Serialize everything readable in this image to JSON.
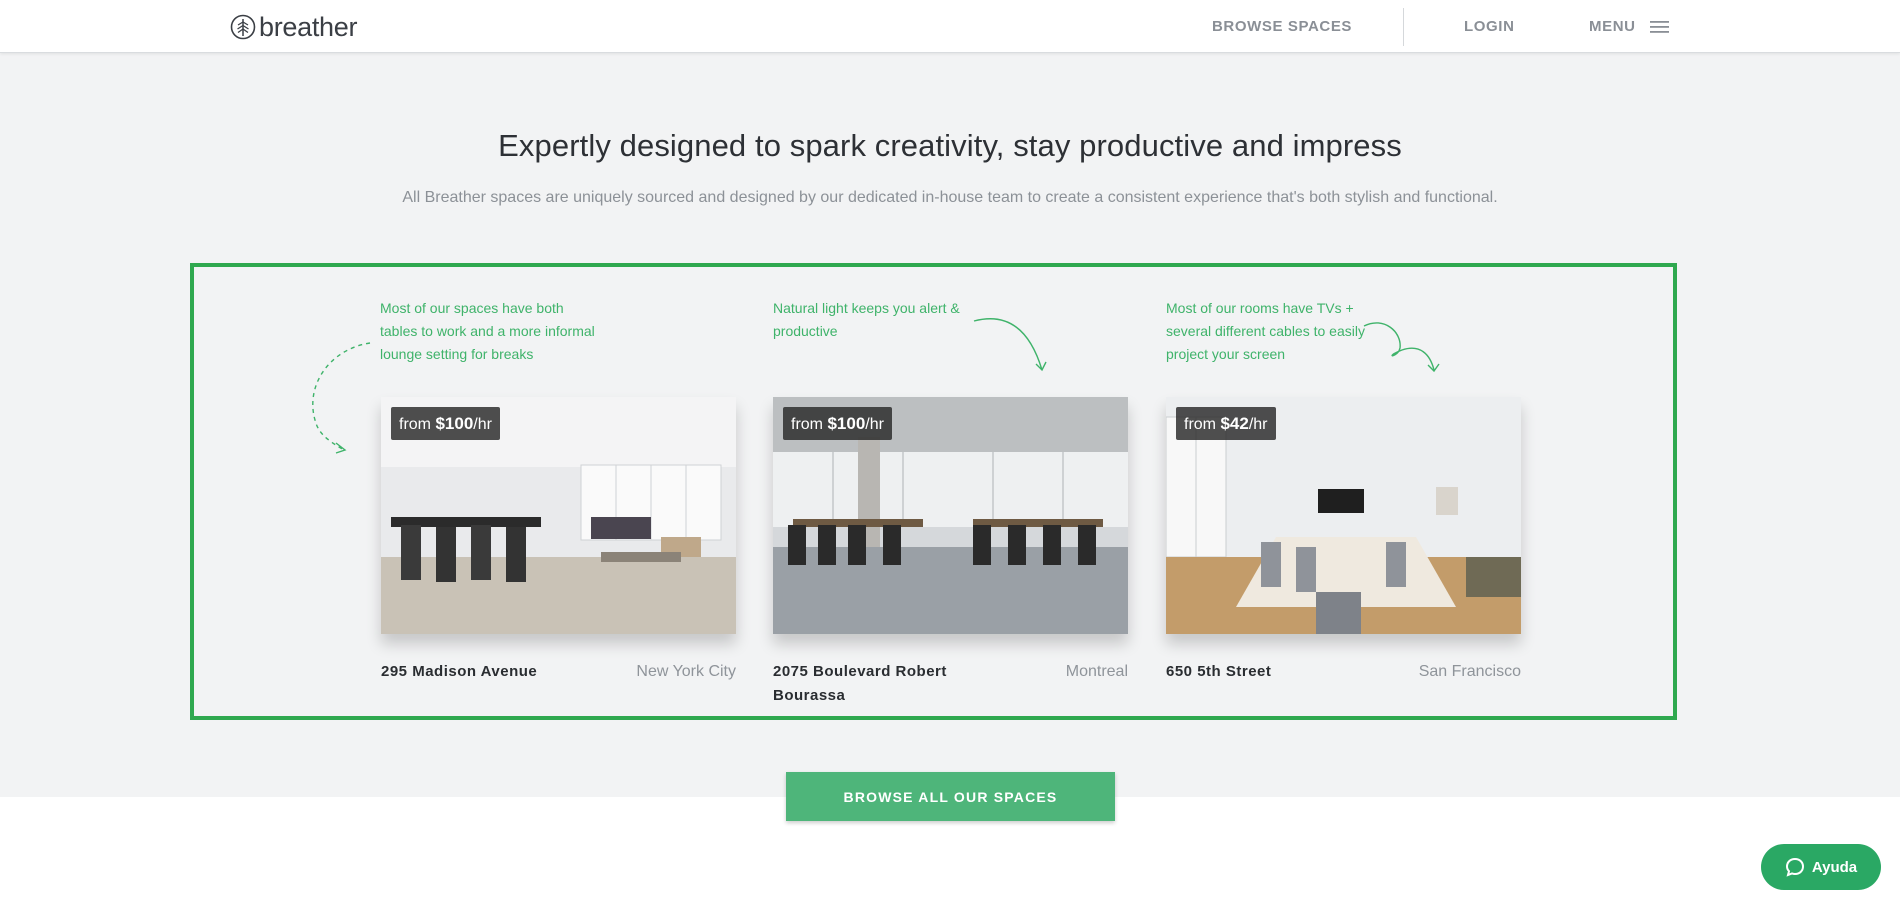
{
  "header": {
    "logo_text": "breather",
    "nav": {
      "browse": "BROWSE SPACES",
      "login": "LOGIN",
      "menu": "MENU"
    }
  },
  "hero": {
    "title": "Expertly designed to spark creativity, stay productive and impress",
    "subtitle": "All Breather spaces are uniquely sourced and designed by our dedicated in-house team to create a consistent experience that's both stylish and functional."
  },
  "spaces": [
    {
      "annotation": "Most of our spaces have both tables to work and a more informal lounge setting for breaks",
      "price_prefix": "from ",
      "price": "$100",
      "price_unit": "/hr",
      "address": "295 Madison Avenue",
      "city": "New York City"
    },
    {
      "annotation": "Natural light keeps you alert & productive",
      "price_prefix": "from ",
      "price": "$100",
      "price_unit": "/hr",
      "address": "2075 Boulevard Robert Bourassa",
      "city": "Montreal"
    },
    {
      "annotation": "Most of our rooms have TVs + several different cables to easily project your screen",
      "price_prefix": "from ",
      "price": "$42",
      "price_unit": "/hr",
      "address": "650 5th Street",
      "city": "San Francisco"
    }
  ],
  "cta": {
    "label": "BROWSE ALL OUR SPACES"
  },
  "help": {
    "label": "Ayuda"
  },
  "colors": {
    "accent_green": "#4eb57a",
    "highlight_border": "#2fa84f",
    "annotation_green": "#3fb36a",
    "help_green": "#2aa864"
  },
  "icons": [
    "breather-logo-icon",
    "hamburger-menu-icon",
    "chat-bubble-icon"
  ]
}
